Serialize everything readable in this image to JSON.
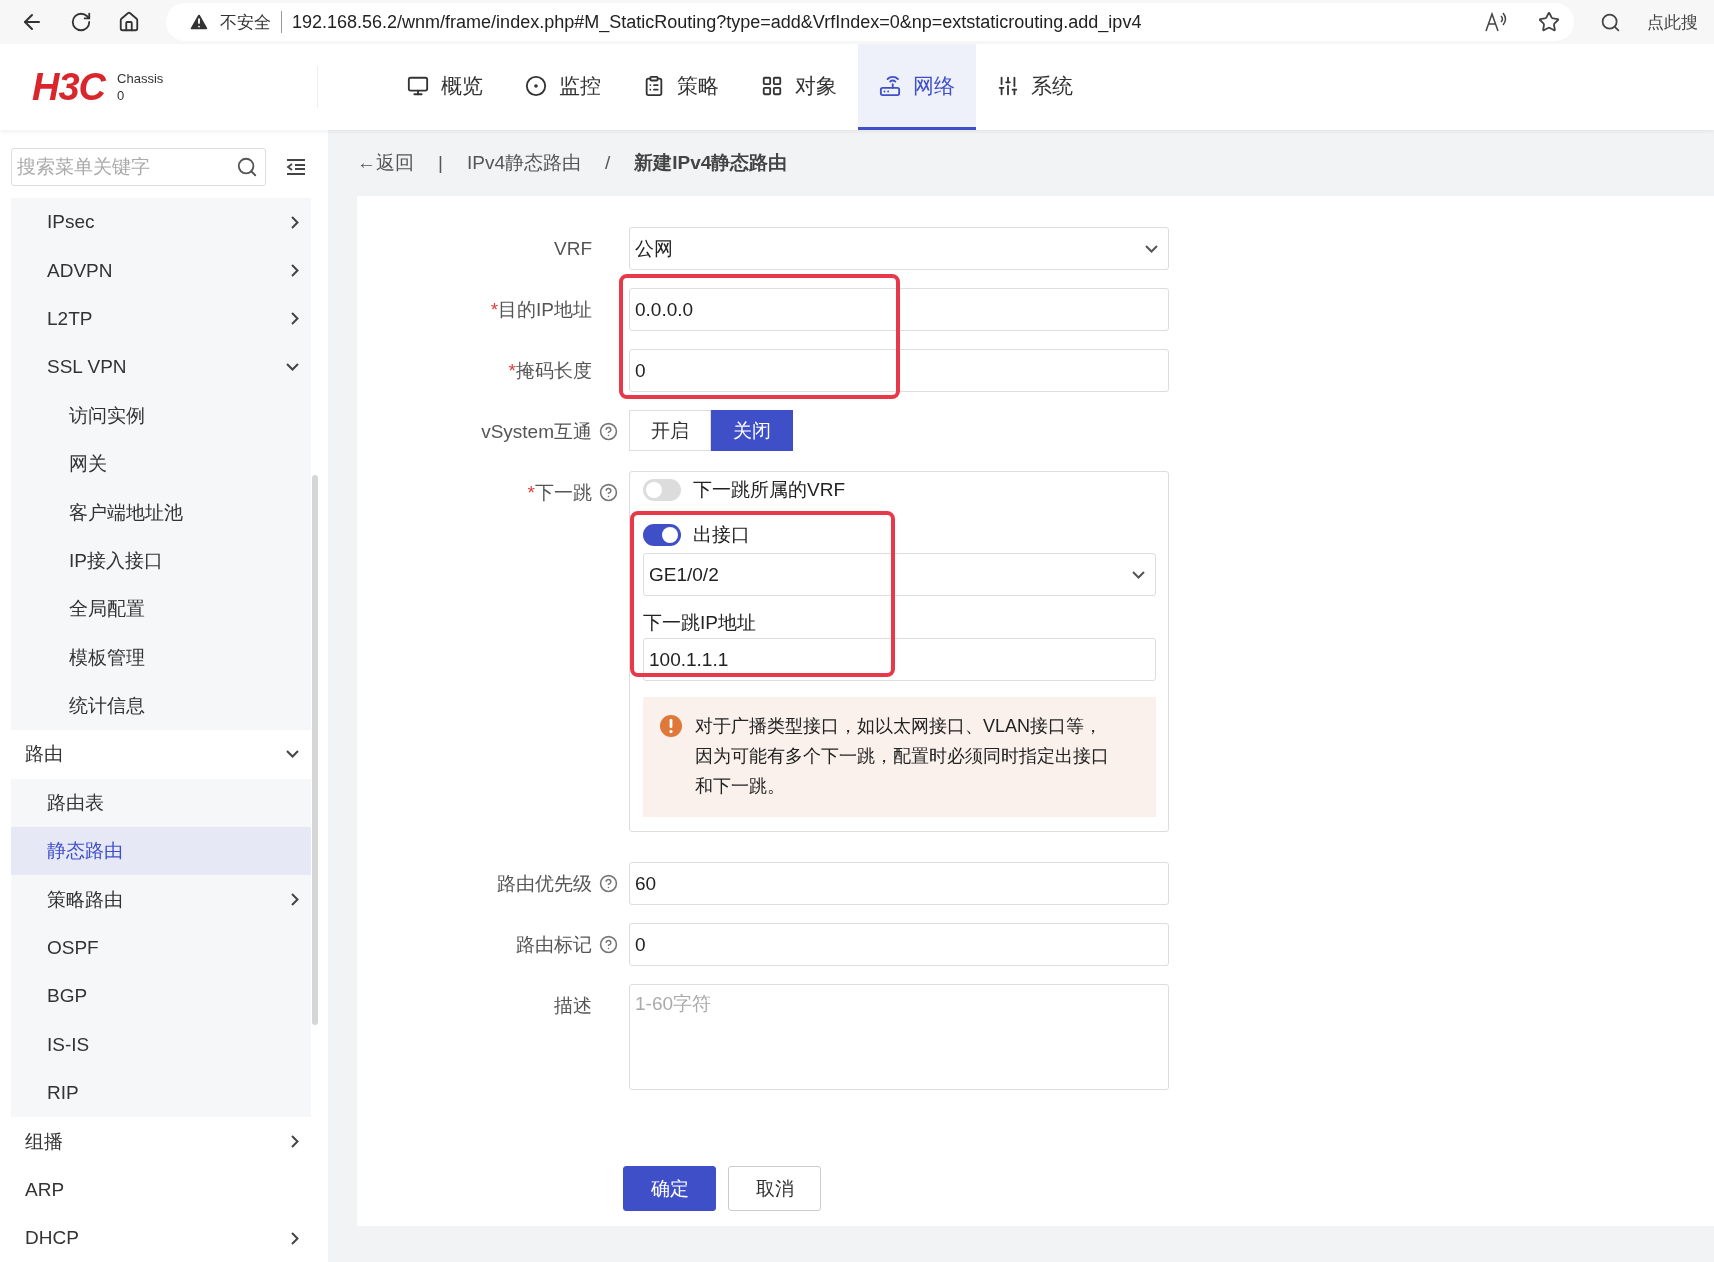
{
  "browser": {
    "security": "不安全",
    "url": "192.168.56.2/wnm/frame/index.php#M_StaticRouting?type=add&VrfIndex=0&np=extstaticrouting.add_ipv4",
    "search_hint": "点此搜"
  },
  "header": {
    "logo": "H3C",
    "device": "Chassis",
    "slot": "0",
    "tabs": [
      {
        "label": "概览",
        "selected": false
      },
      {
        "label": "监控",
        "selected": false
      },
      {
        "label": "策略",
        "selected": false
      },
      {
        "label": "对象",
        "selected": false
      },
      {
        "label": "网络",
        "selected": true
      },
      {
        "label": "系统",
        "selected": false
      }
    ]
  },
  "sidebar": {
    "search": {
      "placeholder": "搜索菜单关键字"
    },
    "items": [
      {
        "children": [
          {
            "label": "IPsec",
            "expanded": false,
            "selected": false
          },
          {
            "label": "ADVPN",
            "expanded": false,
            "selected": false
          },
          {
            "label": "L2TP",
            "expanded": false,
            "selected": false
          },
          {
            "label": "SSL VPN",
            "expanded": true,
            "selected": false,
            "children": [
              {
                "label": "访问实例",
                "selected": false
              },
              {
                "label": "网关",
                "selected": false
              },
              {
                "label": "客户端地址池",
                "selected": false
              },
              {
                "label": "IP接入接口",
                "selected": false
              },
              {
                "label": "全局配置",
                "selected": false
              },
              {
                "label": "模板管理",
                "selected": false
              },
              {
                "label": "统计信息",
                "selected": false
              }
            ]
          }
        ]
      },
      {
        "label": "路由",
        "expanded": true,
        "selected": false,
        "children": [
          {
            "label": "路由表",
            "selected": false
          },
          {
            "label": "静态路由",
            "selected": true
          },
          {
            "label": "策略路由",
            "expanded": false,
            "selected": false
          },
          {
            "label": "OSPF",
            "selected": false
          },
          {
            "label": "BGP",
            "selected": false
          },
          {
            "label": "IS-IS",
            "selected": false
          },
          {
            "label": "RIP",
            "selected": false
          }
        ]
      },
      {
        "label": "组播",
        "expanded": false,
        "selected": false
      },
      {
        "label": "ARP",
        "selected": false
      },
      {
        "label": "DHCP",
        "expanded": false,
        "selected": false
      }
    ]
  },
  "breadcrumb": {
    "back": "←返回",
    "separator": "|",
    "parent": "IPv4静态路由",
    "divider": "/",
    "current": "新建IPv4静态路由"
  },
  "form": {
    "rows": [
      {
        "kind": "select",
        "label": "VRF",
        "value": "公网"
      },
      {
        "kind": "input",
        "label": "目的IP地址",
        "required_mark": "*",
        "value": "0.0.0.0"
      },
      {
        "kind": "input",
        "label": "掩码长度",
        "required_mark": "*",
        "value": "0"
      },
      {
        "kind": "segmented",
        "label": "vSystem互通",
        "help": true,
        "options": [
          {
            "label": "开启",
            "selected": false
          },
          {
            "label": "关闭",
            "selected": true
          }
        ]
      },
      {
        "kind": "nexthop",
        "label": "下一跳",
        "required_mark": "*",
        "help": true,
        "vrf_toggle": {
          "label": "下一跳所属的VRF",
          "on": false
        },
        "interface_toggle": {
          "label": "出接口",
          "on": true
        },
        "interface": "GE1/0/2",
        "ip_label": "下一跳IP地址",
        "ip": "100.1.1.1",
        "notice": "对于广播类型接口，如以太网接口、VLAN接口等，因为可能有多个下一跳，配置时必须同时指定出接口和下一跳。"
      },
      {
        "kind": "input",
        "label": "路由优先级",
        "help": true,
        "value": "60"
      },
      {
        "kind": "input",
        "label": "路由标记",
        "help": true,
        "value": "0"
      },
      {
        "kind": "textarea",
        "label": "描述",
        "placeholder": "1-60字符"
      }
    ],
    "buttons": [
      {
        "label": "确定",
        "primary": true
      },
      {
        "label": "取消",
        "primary": false
      }
    ]
  }
}
